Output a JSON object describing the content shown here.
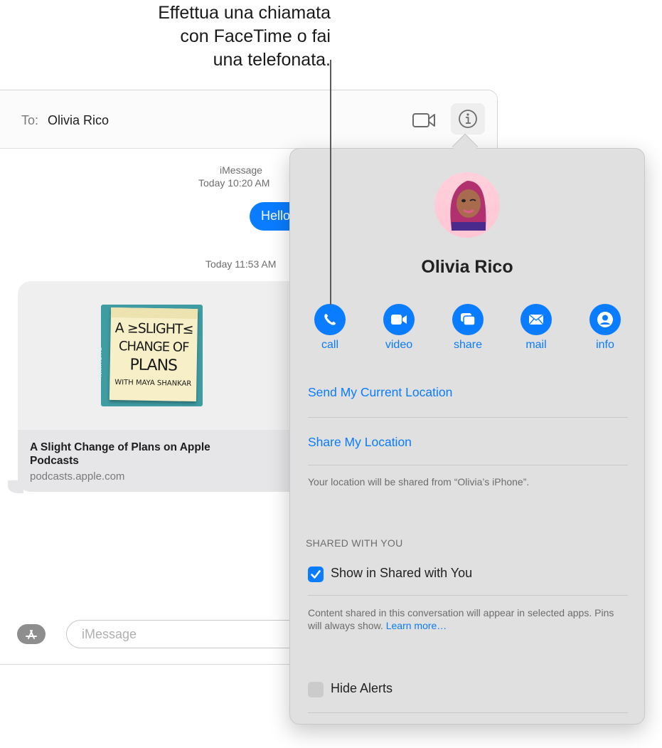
{
  "callout": {
    "lines": [
      "Effettua una chiamata",
      "con FaceTime o fai",
      "una telefonata."
    ]
  },
  "header": {
    "to_label": "To:",
    "to_value": "Olivia Rico",
    "video_icon": "video-camera-icon",
    "info_icon": "info-icon"
  },
  "conversation": {
    "service_label": "iMessage",
    "timestamp_1": "Today 10:20 AM",
    "outgoing_message": "Hello",
    "timestamp_2": "Today 11:53 AM",
    "link_preview": {
      "title": "A Slight Change of Plans on Apple Podcasts",
      "url": "podcasts.apple.com",
      "artwork": {
        "publisher": "PUSHKIN",
        "line1": "A ≥SLIGHT≤",
        "line2": "CHANGE OF",
        "line3": "PLANS",
        "line4": "WITH MAYA SHANKAR"
      }
    }
  },
  "composer": {
    "placeholder": "iMessage",
    "apps_icon": "app-store-icon"
  },
  "details_popover": {
    "contact_name": "Olivia Rico",
    "actions": [
      {
        "label": "call",
        "icon": "phone-icon"
      },
      {
        "label": "video",
        "icon": "video-icon"
      },
      {
        "label": "share",
        "icon": "screen-share-icon"
      },
      {
        "label": "mail",
        "icon": "envelope-icon"
      },
      {
        "label": "info",
        "icon": "person-circle-icon"
      }
    ],
    "send_location": "Send My Current Location",
    "share_location": "Share My Location",
    "location_note": "Your location will be shared from “Olivia’s iPhone”.",
    "shared_section_title": "SHARED WITH YOU",
    "show_in_shared": {
      "label": "Show in Shared with You",
      "checked": true
    },
    "shared_note": "Content shared in this conversation will appear in selected apps. Pins will always show.",
    "learn_more": "Learn more…",
    "hide_alerts": {
      "label": "Hide Alerts",
      "checked": false
    }
  },
  "colors": {
    "accent": "#0a7cff",
    "popover_bg": "#e0e0e0",
    "artwork_teal": "#3f9ca3",
    "note_yellow": "#f7efc8"
  }
}
